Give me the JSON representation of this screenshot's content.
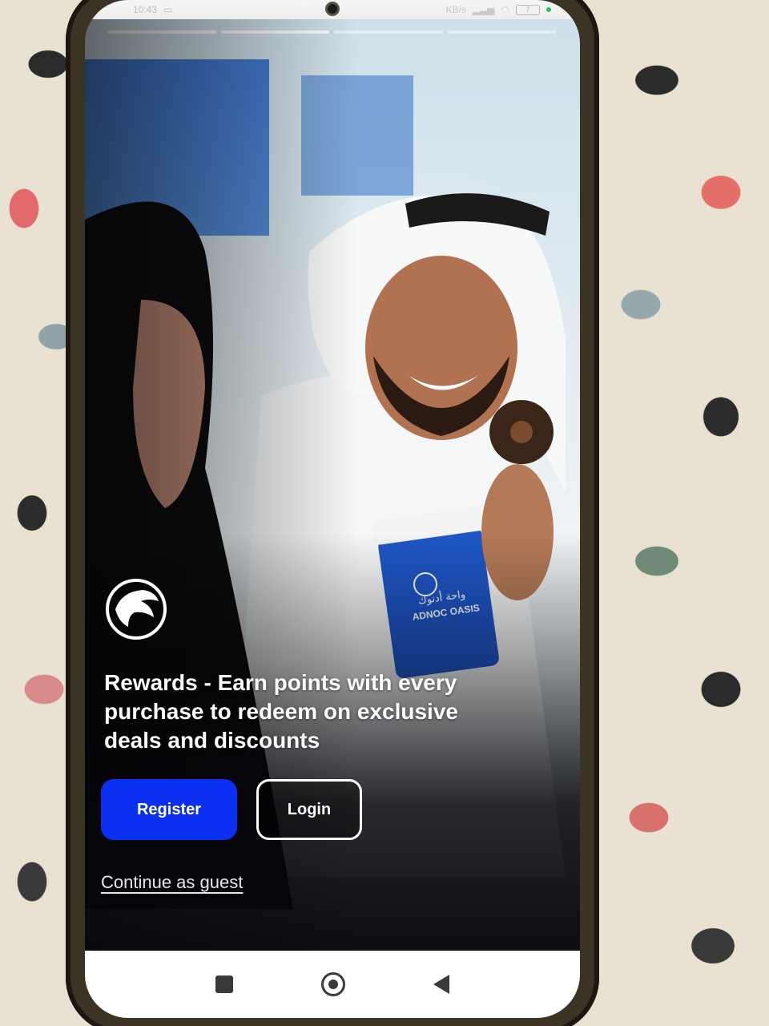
{
  "status_bar": {
    "time": "10:43",
    "net_speed": "KB/s"
  },
  "onboarding": {
    "progress_total": 4,
    "progress_active": 2,
    "headline": "Rewards - Earn points with every purchase to redeem on exclusive deals and discounts"
  },
  "hero_image": {
    "cup_brand_arabic": "واحة أدنوك",
    "cup_brand_english": "ADNOC OASIS"
  },
  "actions": {
    "register_label": "Register",
    "login_label": "Login",
    "guest_label": "Continue as guest"
  },
  "colors": {
    "register_bg": "#0a2ff0",
    "overlay": "#05050a",
    "text": "#ffffff"
  },
  "icons": {
    "logo": "adnoc-falcon-logo",
    "nav_recent": "square-icon",
    "nav_home": "circle-home-icon",
    "nav_back": "triangle-back-icon"
  }
}
